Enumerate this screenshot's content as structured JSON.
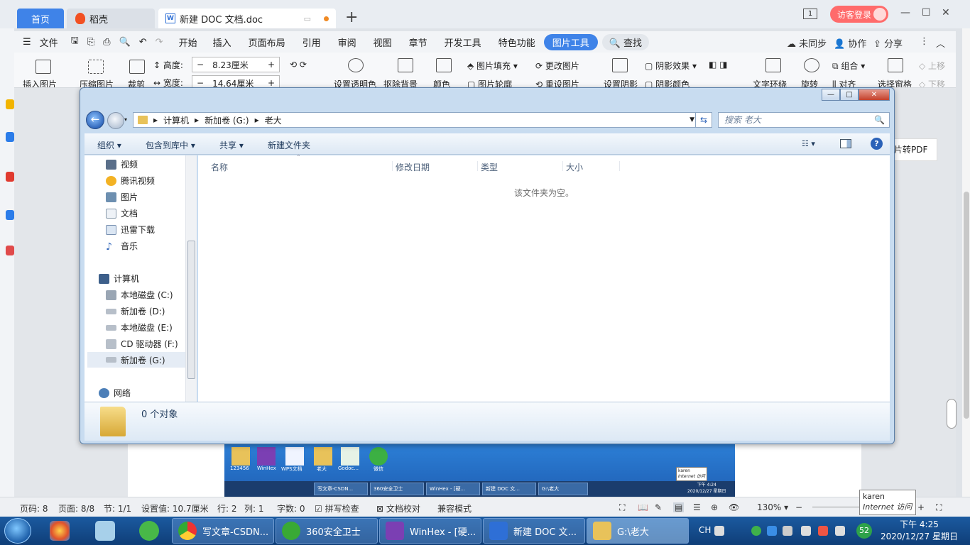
{
  "wps": {
    "tabs": {
      "home": "首页",
      "daoke": "稻壳",
      "doc": "新建 DOC 文档.doc"
    },
    "new_tab": "+",
    "page_count": "1",
    "visitor_login": "访客登录",
    "window_controls": {
      "minimize": "—",
      "restore": "☐",
      "close": "✕"
    },
    "menu": {
      "file": "文件",
      "items": [
        "开始",
        "插入",
        "页面布局",
        "引用",
        "审阅",
        "视图",
        "章节",
        "开发工具",
        "特色功能"
      ],
      "picture_tools": "图片工具",
      "search": "查找",
      "right": {
        "unsynced": "未同步",
        "collab": "协作",
        "share": "分享",
        "more": "⋮",
        "collapse": "︿"
      }
    },
    "tools": {
      "insert_picture": "插入图片",
      "compress_picture": "压缩图片",
      "crop": "裁剪",
      "height_label": "高度:",
      "height_value": "8.23厘米",
      "width_label": "宽度:",
      "width_value": "14.64厘米",
      "set_transparent": "设置透明色",
      "remove_bg": "抠除背景",
      "color": "颜色",
      "picture_fill": "图片填充",
      "picture_outline": "图片轮廓",
      "change_picture": "更改图片",
      "reset_picture": "重设图片",
      "set_shadow": "设置阴影",
      "shadow_effect": "阴影效果",
      "shadow_color": "阴影颜色",
      "text_wrap": "文字环绕",
      "rotate": "旋转",
      "group": "组合",
      "align": "对齐",
      "selection_pane": "选择窗格",
      "move_up": "上移",
      "move_down": "下移"
    },
    "to_pdf": "片转PDF",
    "status": {
      "page_num": "页码: 8",
      "pages": "页面: 8/8",
      "section": "节: 1/1",
      "setting": "设置值: 10.7厘米",
      "row": "行: 2",
      "col": "列: 1",
      "words": "字数: 0",
      "spell": "拼写检查",
      "proof": "文档校对",
      "compat": "兼容模式",
      "zoom": "130%"
    },
    "tooltip": {
      "user": "karen",
      "zone": "Internet 访问"
    }
  },
  "explorer": {
    "controls": {
      "minimize": "—",
      "maximize": "□",
      "close": "✕"
    },
    "breadcrumb": [
      "计算机",
      "新加卷 (G:)",
      "老大"
    ],
    "search_placeholder": "搜索 老大",
    "commands": {
      "organize": "组织",
      "include_library": "包含到库中",
      "share": "共享",
      "new_folder": "新建文件夹"
    },
    "nav": {
      "video": "视频",
      "tencent_video": "腾讯视频",
      "pictures": "图片",
      "documents": "文档",
      "xunlei": "迅雷下载",
      "music": "音乐",
      "computer": "计算机",
      "drive_c": "本地磁盘 (C:)",
      "drive_d": "新加卷 (D:)",
      "drive_e": "本地磁盘 (E:)",
      "drive_f": "CD 驱动器 (F:)",
      "drive_g": "新加卷 (G:)",
      "network": "网络"
    },
    "columns": {
      "name": "名称",
      "modified": "修改日期",
      "type": "类型",
      "size": "大小"
    },
    "empty_message": "该文件夹为空。",
    "object_count": "0 个对象"
  },
  "embedded_image": {
    "icons": [
      "123456",
      "WinHex",
      "WPS文档",
      "老大",
      "Godoc...",
      "微信"
    ],
    "tasks": [
      "写文章-CSDN...",
      "360安全卫士",
      "WinHex - [硬...",
      "新建 DOC 文...",
      "G:\\老大"
    ],
    "tooltip_user": "karen",
    "tooltip_zone": "Internet 访问",
    "clock_time": "下午 4:24",
    "clock_date": "2020/12/27 星期日"
  },
  "taskbar": {
    "tasks": [
      "写文章-CSDN...",
      "360安全卫士",
      "WinHex - [硬...",
      "新建 DOC 文...",
      "G:\\老大"
    ],
    "tray": {
      "lang": "CH",
      "badge": "52"
    },
    "clock_time": "下午 4:25",
    "clock_date": "2020/12/27 星期日"
  }
}
